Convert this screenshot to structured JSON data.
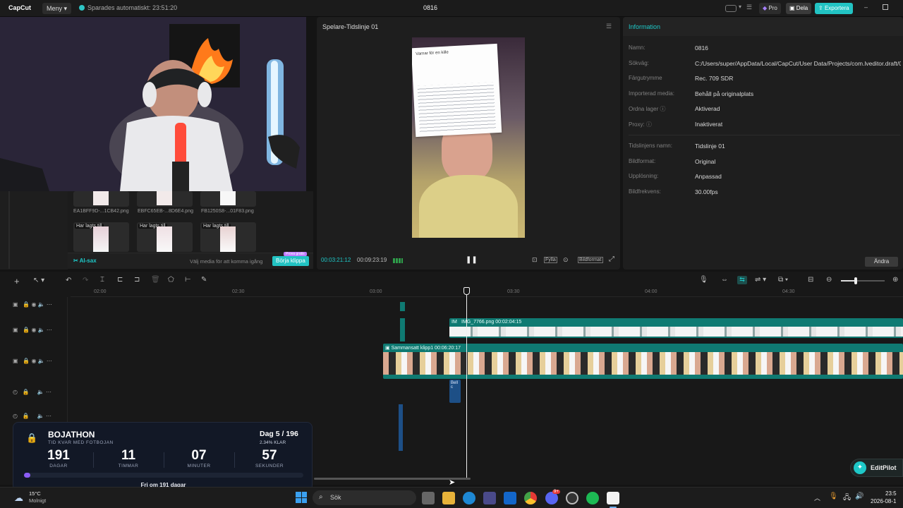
{
  "topbar": {
    "logo": "CapCut",
    "menu_label": "Meny",
    "autosave": "Sparades automatiskt: 23:51:20",
    "project_title": "0816",
    "pro_label": "Pro",
    "share_label": "Dela",
    "export_label": "Exportera"
  },
  "media": {
    "thumbs": [
      {
        "name": "EA1BFF9D-...1CB42.png"
      },
      {
        "name": "EBFC65EB-...8D6E4.png"
      },
      {
        "name": "FB1250S8-...01F83.png"
      }
    ],
    "added_label": "Har lagts till",
    "ai_label": "AI-sax",
    "hint": "Välj media för att komma igång",
    "start_button": "Börja klippa",
    "free_badge": "Prova gratis"
  },
  "player": {
    "title": "Spelare-Tidslinje 01",
    "current_time": "00:03:21:12",
    "total_time": "00:09:23:19",
    "fit_label": "Fylla",
    "ratio_label": "Bildformat",
    "note_title": "Varnar för en kille"
  },
  "info": {
    "title": "Information",
    "rows": [
      {
        "label": "Namn:",
        "value": "0816"
      },
      {
        "label": "Sökväg:",
        "value": "C:/Users/super/AppData/Local/CapCut/User Data/Projects/com.lveditor.draft/08"
      },
      {
        "label": "Färgutrymme",
        "value": "Rec. 709 SDR"
      },
      {
        "label": "Importerad media:",
        "value": "Behåll på originalplats"
      },
      {
        "label": "Ordna lager ⓘ",
        "value": "Aktiverad"
      },
      {
        "label": "Proxy: ⓘ",
        "value": "Inaktiverat"
      }
    ],
    "rows2": [
      {
        "label": "Tidslinjens namn:",
        "value": "Tidslinje 01"
      },
      {
        "label": "Bildformat:",
        "value": "Original"
      },
      {
        "label": "Upplösning:",
        "value": "Anpassad"
      },
      {
        "label": "Bildfrekvens:",
        "value": "30.00fps"
      }
    ],
    "change_button": "Ändra"
  },
  "timeline": {
    "ticks": [
      "02:00",
      "02:30",
      "03:00",
      "03:30",
      "04:00",
      "04:30"
    ],
    "clip_image": "IMG_7766.png  00:02:04:15",
    "clip_image_short": "IM",
    "clip_compound": "Sammansatt klipp1  00:06:20:17",
    "clip_audio": "Bell c"
  },
  "overlay": {
    "title": "BOJATHON",
    "subtitle": "TID KVAR MED FOTBOJAN",
    "day": "Dag 5 / 196",
    "percent": "2.34% KLAR",
    "days": "191",
    "days_label": "DAGAR",
    "hours": "11",
    "hours_label": "TIMMAR",
    "minutes": "07",
    "minutes_label": "MINUTER",
    "seconds": "57",
    "seconds_label": "SEKUNDER",
    "progress": 0.0234,
    "footer": "Fri om 191 dagar"
  },
  "editpilot": "EditPilot",
  "taskbar": {
    "temp": "15°C",
    "weather": "Molnigt",
    "search": "Sök",
    "clock_time": "23:5",
    "clock_date": "2026-08-1",
    "badge": "9+"
  },
  "colors": {
    "accent": "#1ec8c8",
    "track_teal": "#0f7a72",
    "export": "#22c3c3"
  }
}
